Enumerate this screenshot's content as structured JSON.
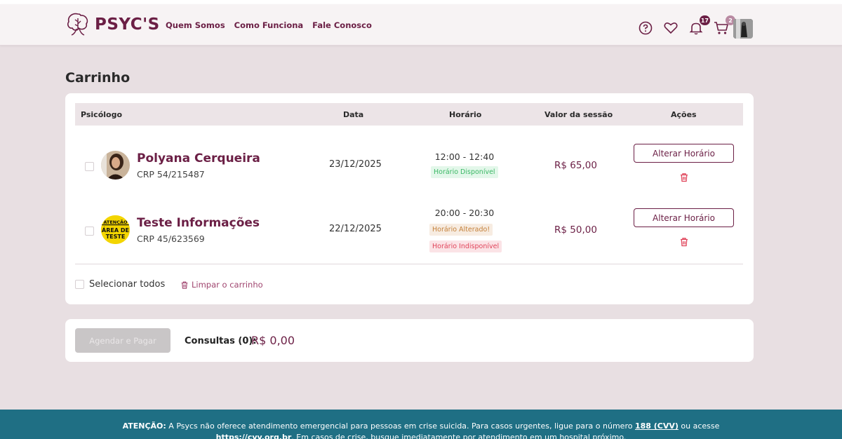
{
  "header": {
    "brand": "PSYC'S",
    "nav": [
      "Quem Somos",
      "Como Funciona",
      "Fale Conosco"
    ],
    "notifications_count": "17",
    "cart_count": "2"
  },
  "page_title": "Carrinho",
  "table": {
    "columns": [
      "Psicólogo",
      "Data",
      "Horário",
      "Valor da sessão",
      "Ações"
    ],
    "rows": [
      {
        "name": "Polyana Cerqueira",
        "crp": "CRP 54/215487",
        "date": "23/12/2025",
        "time": "12:00 - 12:40",
        "tags": [
          "Horário Disponível"
        ],
        "price": "R$ 65,00",
        "action": "Alterar Horário"
      },
      {
        "name": "Teste Informações",
        "crp": "CRP 45/623569",
        "date": "22/12/2025",
        "time": "20:00 - 20:30",
        "tags": [
          "Horário Alterado!",
          "Horário Indisponível"
        ],
        "price": "R$ 50,00",
        "action": "Alterar Horário",
        "avatar_text": [
          "ATENÇÃO",
          "ÁREA DE",
          "TESTE"
        ]
      }
    ]
  },
  "select_all_label": "Selecionar todos",
  "clear_cart_label": "Limpar o carrinho",
  "summary": {
    "pay_button": "Agendar e Pagar",
    "label": "Consultas (0):",
    "value": "R$ 0,00"
  },
  "footer": {
    "attention": "ATENÇÃO:",
    "line1": " A Psycs não oferece atendimento emergencial para pessoas em crise suicida. Para casos urgentes, ligue para o número ",
    "cvv": "188 (CVV)",
    "line1_end": " ou acesse",
    "link": "https://cvv.org.br",
    "line2": ". Em casos de crise, busque imediatamente por atendimento em um hospital próximo."
  },
  "colors": {
    "brand": "#6b1f45",
    "background": "#e8dfe2",
    "footer": "#1f6f84"
  }
}
